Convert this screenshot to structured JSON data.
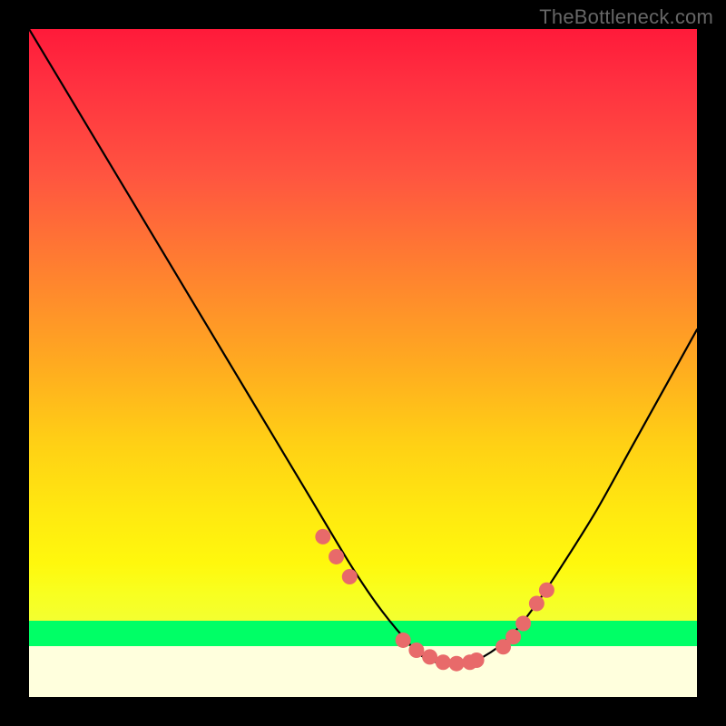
{
  "watermark": "TheBottleneck.com",
  "chart_data": {
    "type": "line",
    "title": "",
    "xlabel": "",
    "ylabel": "",
    "xlim": [
      0,
      100
    ],
    "ylim": [
      0,
      100
    ],
    "grid": false,
    "background_gradient": {
      "stops": [
        {
          "pos": 0,
          "color": "#ff1a3a"
        },
        {
          "pos": 50,
          "color": "#ffb018"
        },
        {
          "pos": 80,
          "color": "#fff80d"
        },
        {
          "pos": 88.6,
          "color": "#f3ff30"
        },
        {
          "pos": 88.6,
          "color": "#00ff66"
        },
        {
          "pos": 92.4,
          "color": "#00ff66"
        },
        {
          "pos": 92.4,
          "color": "#ffffdd"
        },
        {
          "pos": 100,
          "color": "#ffffdd"
        }
      ]
    },
    "series": [
      {
        "name": "bottleneck-curve",
        "x": [
          0.0,
          6.0,
          12.0,
          18.0,
          24.0,
          30.0,
          36.0,
          42.0,
          48.0,
          52.0,
          56.0,
          59.0,
          62.0,
          65.0,
          68.0,
          72.0,
          76.0,
          80.0,
          85.0,
          90.0,
          95.0,
          100.0
        ],
        "y": [
          100.0,
          90.0,
          80.0,
          70.0,
          60.0,
          50.0,
          40.0,
          30.0,
          20.0,
          14.0,
          9.0,
          6.0,
          5.0,
          5.0,
          6.0,
          9.0,
          14.0,
          20.0,
          28.0,
          37.0,
          46.0,
          55.0
        ]
      }
    ],
    "highlight_points": {
      "name": "sweet-spot-markers",
      "color": "#e86a6a",
      "x": [
        44.0,
        46.0,
        48.0,
        56.0,
        58.0,
        60.0,
        62.0,
        64.0,
        66.0,
        67.0,
        71.0,
        72.5,
        74.0,
        76.0,
        77.5
      ],
      "y": [
        24.0,
        21.0,
        18.0,
        8.5,
        7.0,
        6.0,
        5.2,
        5.0,
        5.2,
        5.5,
        7.5,
        9.0,
        11.0,
        14.0,
        16.0
      ]
    }
  }
}
